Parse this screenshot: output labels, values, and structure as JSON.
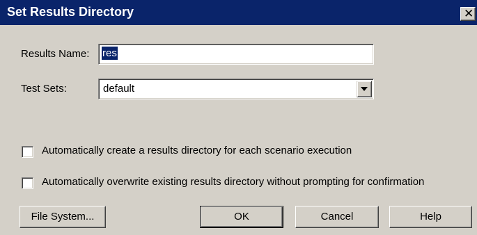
{
  "window": {
    "title": "Set Results Directory",
    "close_glyph": "✕"
  },
  "results_name": {
    "label": "Results Name:",
    "value": "res"
  },
  "test_sets": {
    "label": "Test Sets:",
    "selected": "default"
  },
  "options": [
    {
      "label": "Automatically create a results directory for each scenario execution",
      "checked": false
    },
    {
      "label": "Automatically overwrite existing results directory without prompting for confirmation",
      "checked": false
    }
  ],
  "buttons": {
    "file_system": "File System...",
    "ok": "OK",
    "cancel": "Cancel",
    "help": "Help"
  },
  "colors": {
    "titlebar": "#0a246a",
    "face": "#d4d0c8",
    "selection": "#0a246a"
  }
}
